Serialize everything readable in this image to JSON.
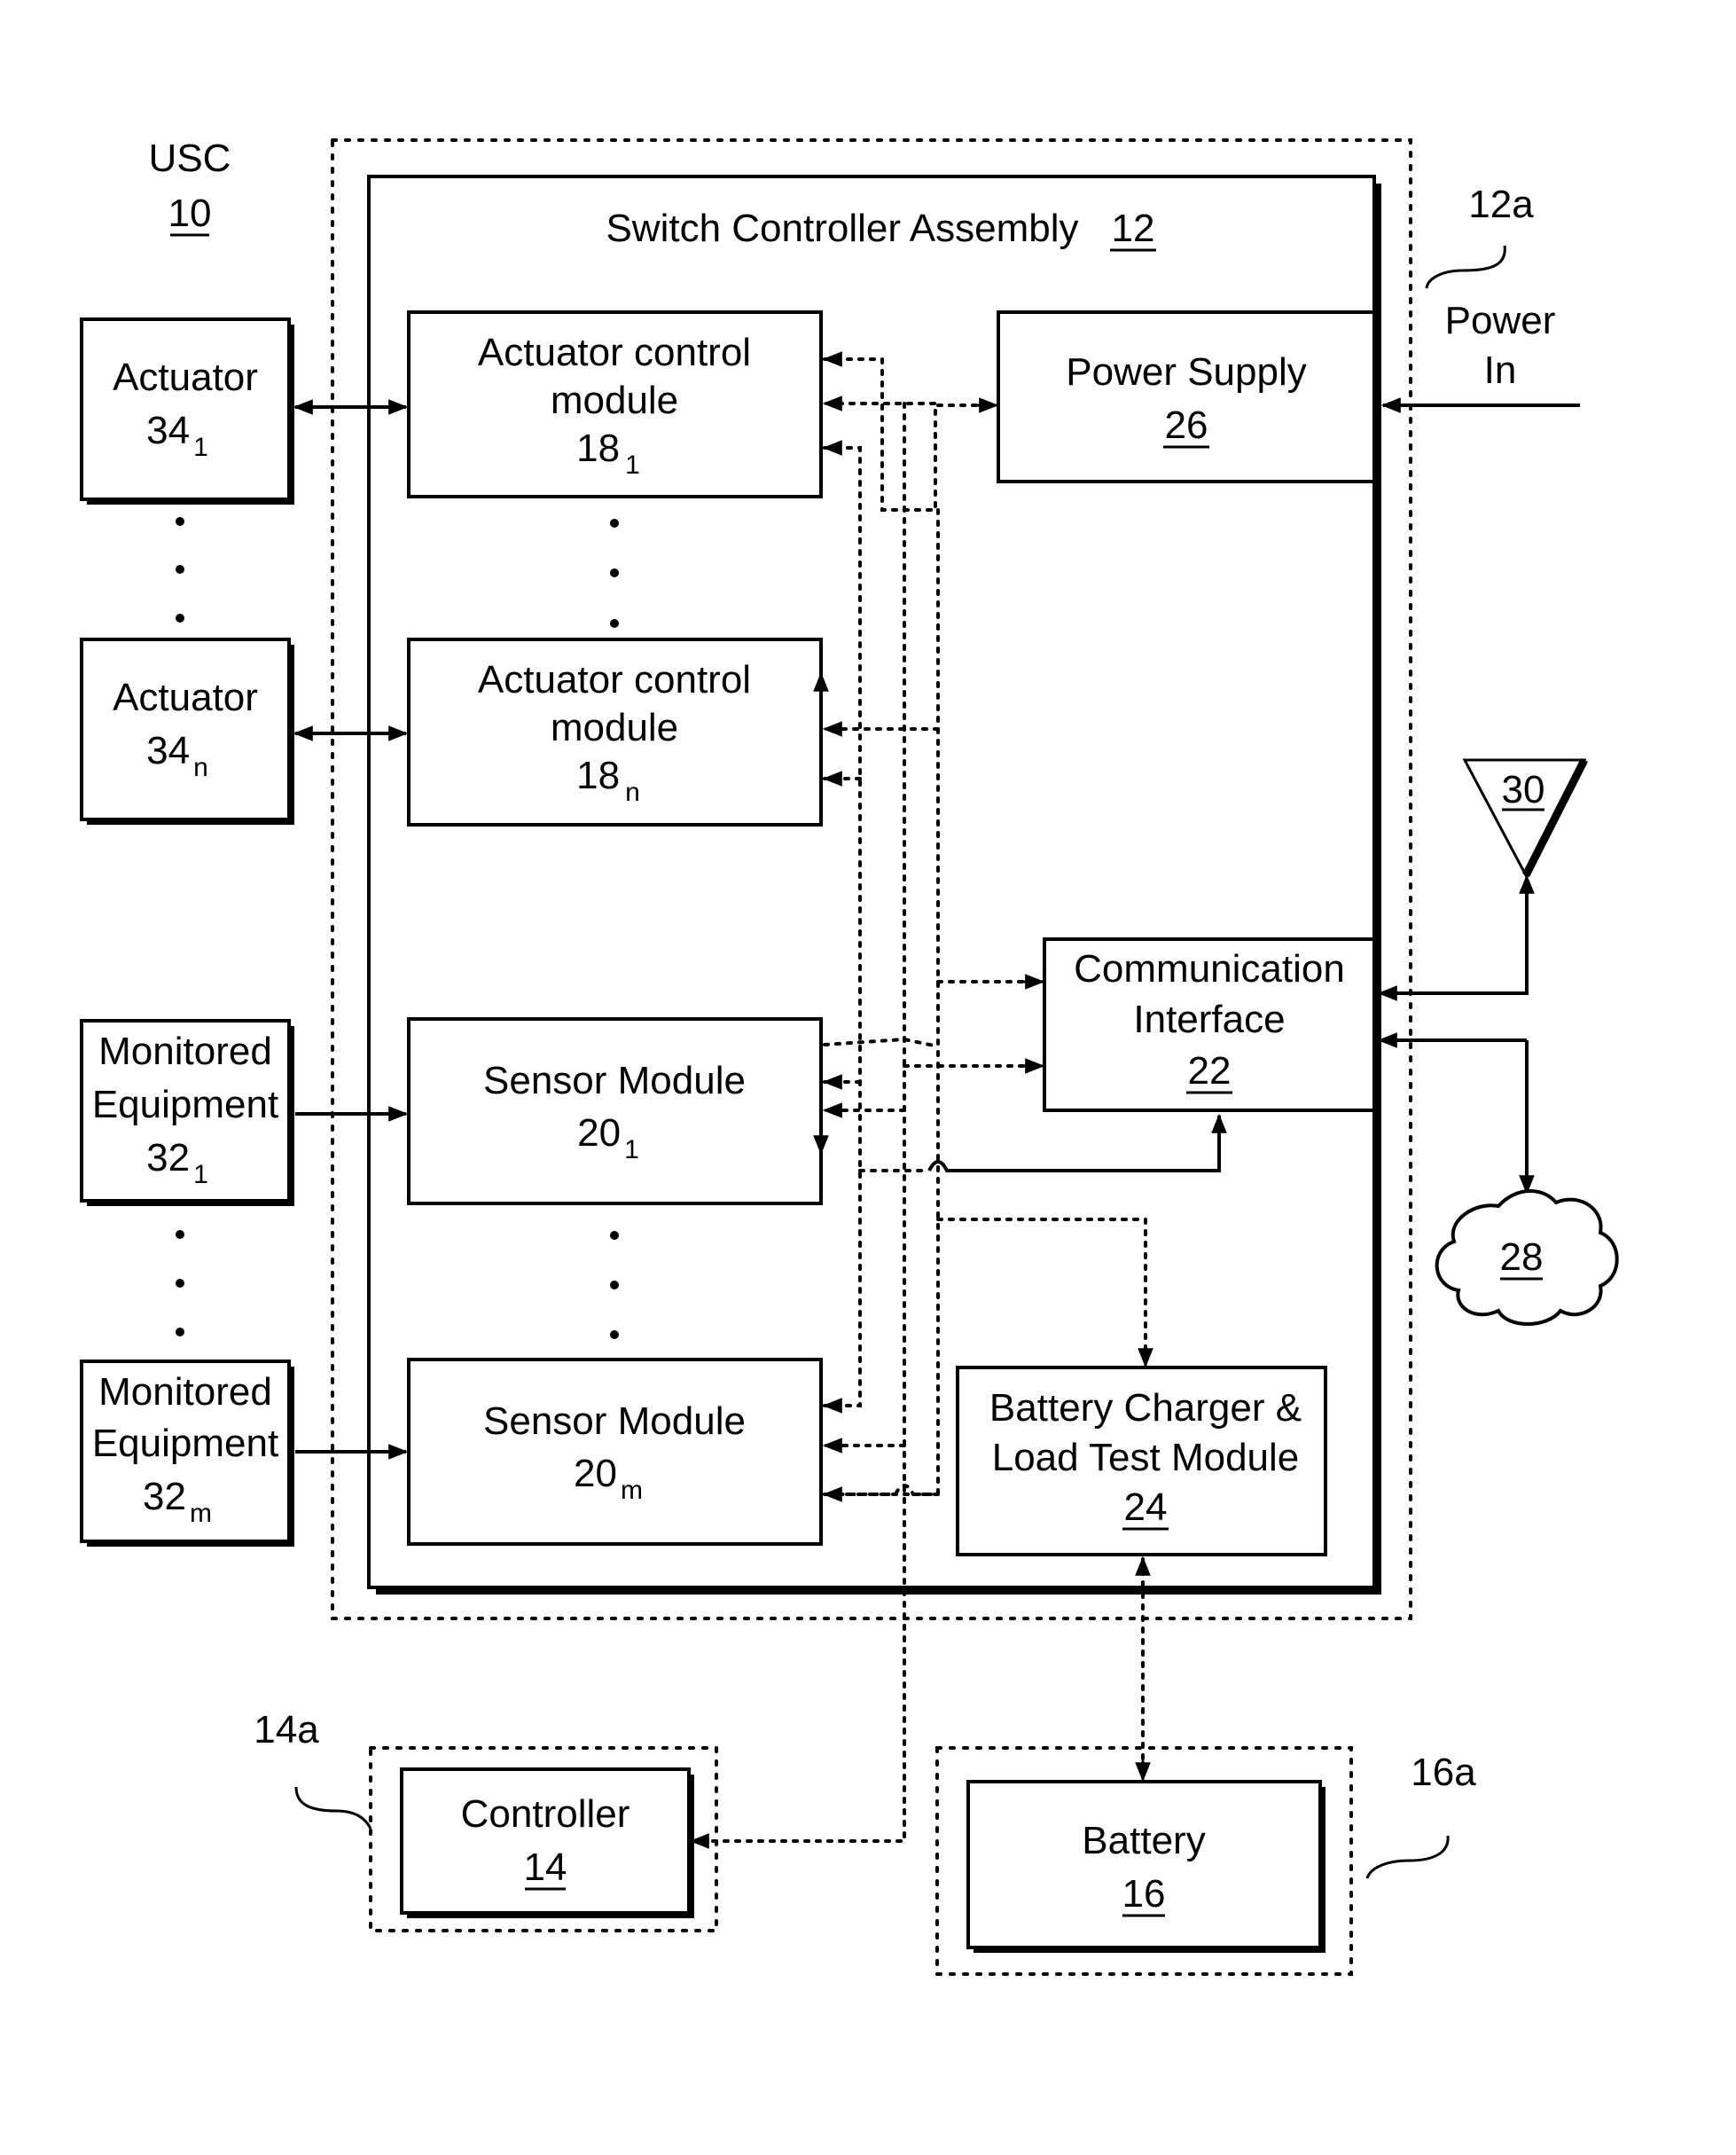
{
  "usc": {
    "name": "USC",
    "ref": "10"
  },
  "switch_controller_assembly": {
    "title": "Switch Controller Assembly",
    "ref": "12",
    "enclosure_ref": "12a"
  },
  "power_in": {
    "line1": "Power",
    "line2": "In"
  },
  "actuators": [
    {
      "name": "Actuator",
      "ref": "34",
      "sub": "1"
    },
    {
      "name": "Actuator",
      "ref": "34",
      "sub": "n"
    }
  ],
  "monitored_equipment": [
    {
      "line1": "Monitored",
      "line2": "Equipment",
      "ref": "32",
      "sub": "1"
    },
    {
      "line1": "Monitored",
      "line2": "Equipment",
      "ref": "32",
      "sub": "m"
    }
  ],
  "actuator_control_modules": [
    {
      "line1": "Actuator control",
      "line2": "module",
      "ref": "18",
      "sub": "1"
    },
    {
      "line1": "Actuator control",
      "line2": "module",
      "ref": "18",
      "sub": "n"
    }
  ],
  "sensor_modules": [
    {
      "name": "Sensor Module",
      "ref": "20",
      "sub": "1"
    },
    {
      "name": "Sensor Module",
      "ref": "20",
      "sub": "m"
    }
  ],
  "power_supply": {
    "name": "Power Supply",
    "ref": "26"
  },
  "communication_interface": {
    "line1": "Communication",
    "line2": "Interface",
    "ref": "22"
  },
  "battery_charger": {
    "line1": "Battery Charger &",
    "line2": "Load Test Module",
    "ref": "24"
  },
  "antenna": {
    "ref": "30"
  },
  "network": {
    "ref": "28"
  },
  "controller": {
    "name": "Controller",
    "ref": "14",
    "enclosure_ref": "14a"
  },
  "battery": {
    "name": "Battery",
    "ref": "16",
    "enclosure_ref": "16a"
  },
  "ellipsis": "⋮"
}
